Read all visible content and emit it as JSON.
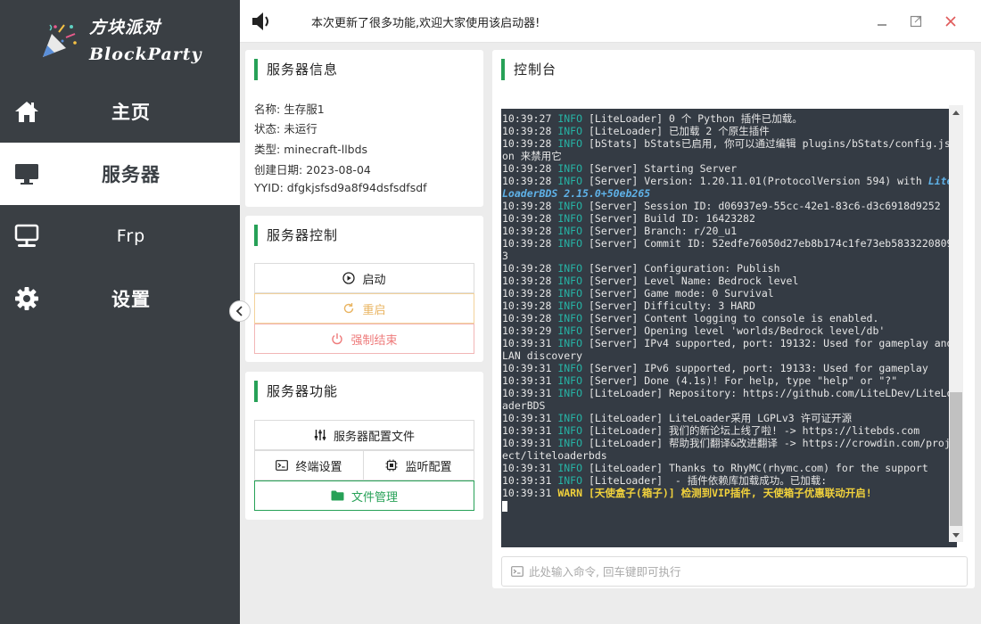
{
  "app": {
    "logo_text_line1": "方块派对",
    "logo_text_line2": "BlockParty"
  },
  "sidebar": {
    "items": [
      {
        "label": "主页",
        "icon": "home-icon"
      },
      {
        "label": "服务器",
        "icon": "monitor-icon"
      },
      {
        "label": "Frp",
        "icon": "network-monitor-icon"
      },
      {
        "label": "设置",
        "icon": "gear-icon"
      }
    ],
    "active": "服务器"
  },
  "topbar": {
    "notice": "本次更新了很多功能,欢迎大家使用该启动器!"
  },
  "server_info": {
    "title": "服务器信息",
    "name_label": "名称:",
    "name_value": "生存服1",
    "status_label": "状态:",
    "status_value": "未运行",
    "type_label": "类型:",
    "type_value": "minecraft-llbds",
    "date_label": "创建日期:",
    "date_value": "2023-08-04",
    "uuid_label": "YYID:",
    "uuid_value": "dfgkjsfsd9a8f94dsfsdfsdf"
  },
  "server_control": {
    "title": "服务器控制",
    "start_label": "启动",
    "restart_label": "重启",
    "kill_label": "强制结束"
  },
  "server_features": {
    "title": "服务器功能",
    "config_label": "服务器配置文件",
    "terminal_label": "终端设置",
    "listen_label": "监听配置",
    "files_label": "文件管理"
  },
  "console": {
    "title": "控制台",
    "input_placeholder": "此处输入命令, 回车键即可执行",
    "lines": [
      {
        "ts": "10:39:27",
        "level": "INFO",
        "msg": "[LiteLoader] 0 个 Python 插件已加载。"
      },
      {
        "ts": "10:39:28",
        "level": "INFO",
        "msg": "[LiteLoader] 已加载 2 个原生插件"
      },
      {
        "ts": "10:39:28",
        "level": "INFO",
        "msg": "[bStats] bStats已启用, 你可以通过编辑 plugins/bStats/config.json 来禁用它"
      },
      {
        "ts": "10:39:28",
        "level": "INFO",
        "msg": "[Server] Starting Server"
      },
      {
        "ts": "10:39:28",
        "level": "INFO",
        "msg": "[Server] Version: 1.20.11.01(ProtocolVersion 594) with ",
        "hl": "LiteLoaderBDS 2.15.0+50eb265"
      },
      {
        "ts": "10:39:28",
        "level": "INFO",
        "msg": "[Server] Session ID: d06937e9-55cc-42e1-83c6-d3c6918d9252"
      },
      {
        "ts": "10:39:28",
        "level": "INFO",
        "msg": "[Server] Build ID: 16423282"
      },
      {
        "ts": "10:39:28",
        "level": "INFO",
        "msg": "[Server] Branch: r/20_u1"
      },
      {
        "ts": "10:39:28",
        "level": "INFO",
        "msg": "[Server] Commit ID: 52edfe76050d27eb8b174c1fe73eb58332208093"
      },
      {
        "ts": "10:39:28",
        "level": "INFO",
        "msg": "[Server] Configuration: Publish"
      },
      {
        "ts": "10:39:28",
        "level": "INFO",
        "msg": "[Server] Level Name: Bedrock level"
      },
      {
        "ts": "10:39:28",
        "level": "INFO",
        "msg": "[Server] Game mode: 0 Survival"
      },
      {
        "ts": "10:39:28",
        "level": "INFO",
        "msg": "[Server] Difficulty: 3 HARD"
      },
      {
        "ts": "10:39:28",
        "level": "INFO",
        "msg": "[Server] Content logging to console is enabled."
      },
      {
        "ts": "10:39:29",
        "level": "INFO",
        "msg": "[Server] Opening level 'worlds/Bedrock level/db'"
      },
      {
        "ts": "10:39:31",
        "level": "INFO",
        "msg": "[Server] IPv4 supported, port: 19132: Used for gameplay and LAN discovery"
      },
      {
        "ts": "10:39:31",
        "level": "INFO",
        "msg": "[Server] IPv6 supported, port: 19133: Used for gameplay"
      },
      {
        "ts": "10:39:31",
        "level": "INFO",
        "msg": "[Server] Done (4.1s)! For help, type \"help\" or \"?\""
      },
      {
        "ts": "10:39:31",
        "level": "INFO",
        "msg": "[LiteLoader] Repository: https://github.com/LiteLDev/LiteLoaderBDS"
      },
      {
        "ts": "10:39:31",
        "level": "INFO",
        "msg": "[LiteLoader] LiteLoader采用 LGPLv3 许可证开源"
      },
      {
        "ts": "10:39:31",
        "level": "INFO",
        "msg": "[LiteLoader] 我们的新论坛上线了啦! -> https://litebds.com"
      },
      {
        "ts": "10:39:31",
        "level": "INFO",
        "msg": "[LiteLoader] 帮助我们翻译&改进翻译 -> https://crowdin.com/project/liteloaderbds"
      },
      {
        "ts": "10:39:31",
        "level": "INFO",
        "msg": "[LiteLoader] Thanks to RhyMC(rhymc.com) for the support"
      },
      {
        "ts": "10:39:31",
        "level": "INFO",
        "msg": "[LiteLoader]  - 插件依赖库加载成功。已加载:"
      },
      {
        "ts": "10:39:31",
        "level": "WARN",
        "msg": "[天使盒子(箱子)] 检测到VIP插件, 天使箱子优惠联动开启!"
      }
    ]
  },
  "colors": {
    "sidebar_bg": "#3a3f44",
    "accent_green": "#27a157",
    "console_bg": "#343b44",
    "info_color": "#26b3a5",
    "warn_color": "#f2d23c",
    "restart_color": "#e9b461",
    "kill_color": "#ee7a7a"
  }
}
